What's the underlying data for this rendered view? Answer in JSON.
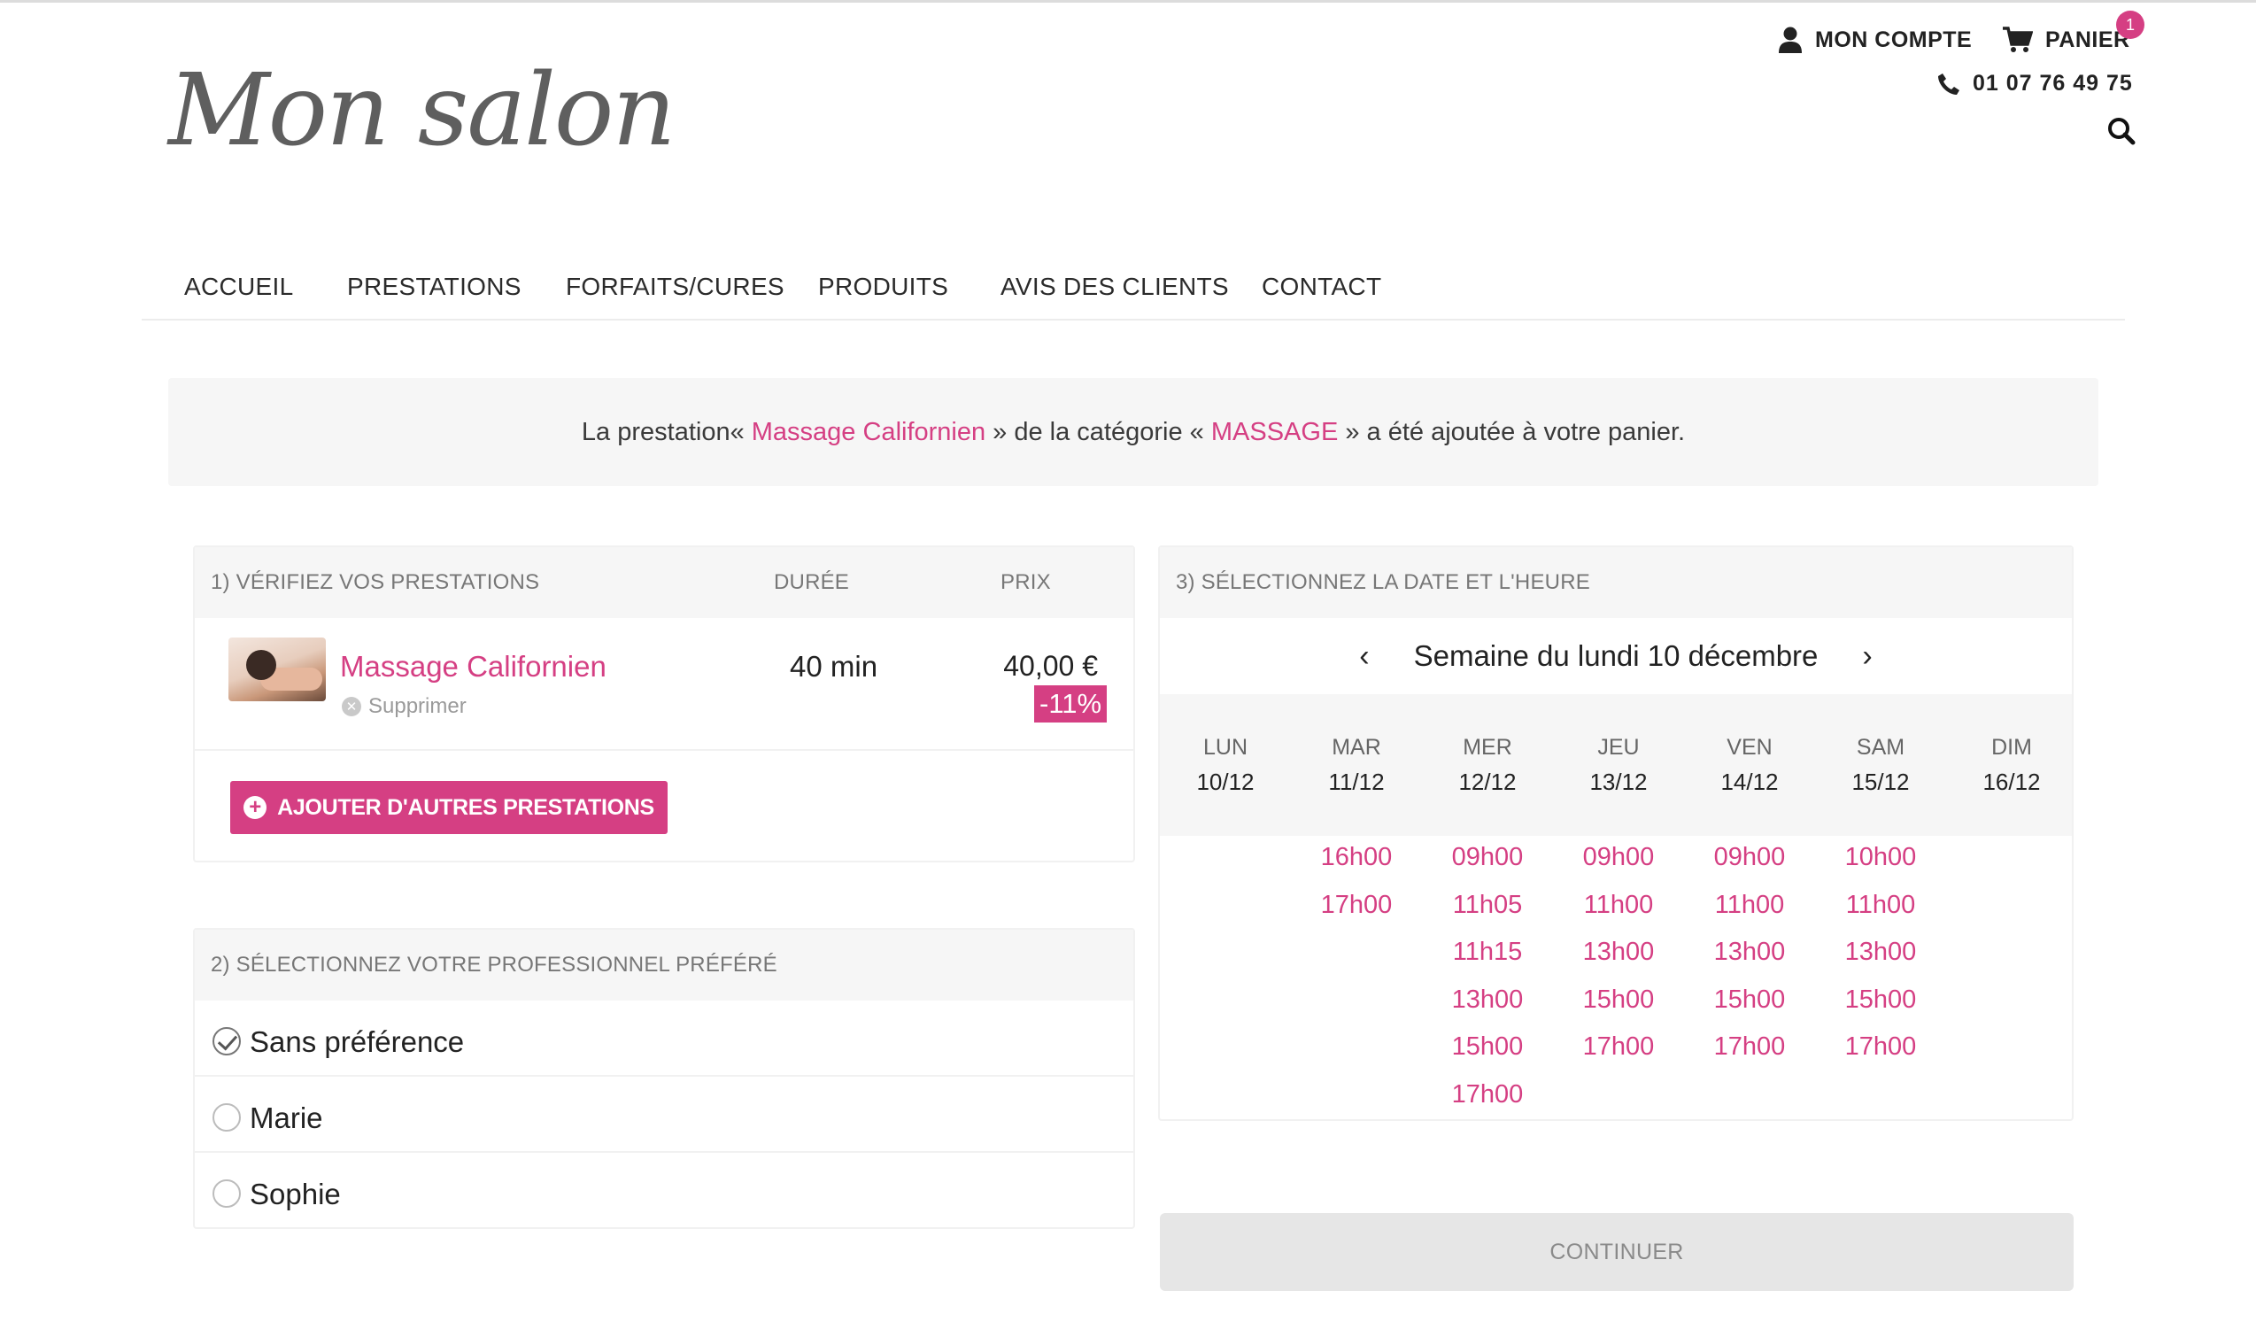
{
  "brand": {
    "logo_text": "Mon salon",
    "accent_color": "#d53f83"
  },
  "header": {
    "account_label": "MON COMPTE",
    "account_icon": "user-icon",
    "cart_label": "PANIER",
    "cart_icon": "cart-icon",
    "cart_count": "1",
    "phone": "01 07 76 49 75",
    "phone_icon": "phone-icon",
    "search_icon": "search-icon"
  },
  "nav": {
    "items": [
      "ACCUEIL",
      "PRESTATIONS",
      "FORFAITS/CURES",
      "PRODUITS",
      "AVIS DES CLIENTS",
      "CONTACT"
    ]
  },
  "notice": {
    "prefix": "La prestation« ",
    "service": "Massage Californien",
    "middle": " » de la catégorie « ",
    "category": "MASSAGE",
    "suffix": " » a été ajoutée à votre panier."
  },
  "step1": {
    "title": "1) VÉRIFIEZ VOS PRESTATIONS",
    "col_duration": "DURÉE",
    "col_price": "PRIX",
    "service": {
      "name": "Massage Californien",
      "delete_label": "Supprimer",
      "duration": "40 min",
      "price": "40,00 €",
      "discount": "-11%"
    },
    "add_button": "AJOUTER D'AUTRES PRESTATIONS"
  },
  "step2": {
    "title": "2) SÉLECTIONNEZ VOTRE PROFESSIONNEL PRÉFÉRÉ",
    "options": [
      {
        "label": "Sans préférence",
        "selected": true
      },
      {
        "label": "Marie",
        "selected": false
      },
      {
        "label": "Sophie",
        "selected": false
      }
    ]
  },
  "step3": {
    "title": "3) SÉLECTIONNEZ LA DATE ET L'HEURE",
    "week_label": "Semaine du lundi 10 décembre",
    "days": [
      {
        "name": "LUN",
        "date": "10/12",
        "slots": []
      },
      {
        "name": "MAR",
        "date": "11/12",
        "slots": [
          "16h00",
          "17h00"
        ]
      },
      {
        "name": "MER",
        "date": "12/12",
        "slots": [
          "09h00",
          "11h05",
          "11h15",
          "13h00",
          "15h00",
          "17h00"
        ]
      },
      {
        "name": "JEU",
        "date": "13/12",
        "slots": [
          "09h00",
          "11h00",
          "13h00",
          "15h00",
          "17h00"
        ]
      },
      {
        "name": "VEN",
        "date": "14/12",
        "slots": [
          "09h00",
          "11h00",
          "13h00",
          "15h00",
          "17h00"
        ]
      },
      {
        "name": "SAM",
        "date": "15/12",
        "slots": [
          "10h00",
          "11h00",
          "13h00",
          "15h00",
          "17h00"
        ]
      },
      {
        "name": "DIM",
        "date": "16/12",
        "slots": []
      }
    ]
  },
  "continue_label": "CONTINUER"
}
